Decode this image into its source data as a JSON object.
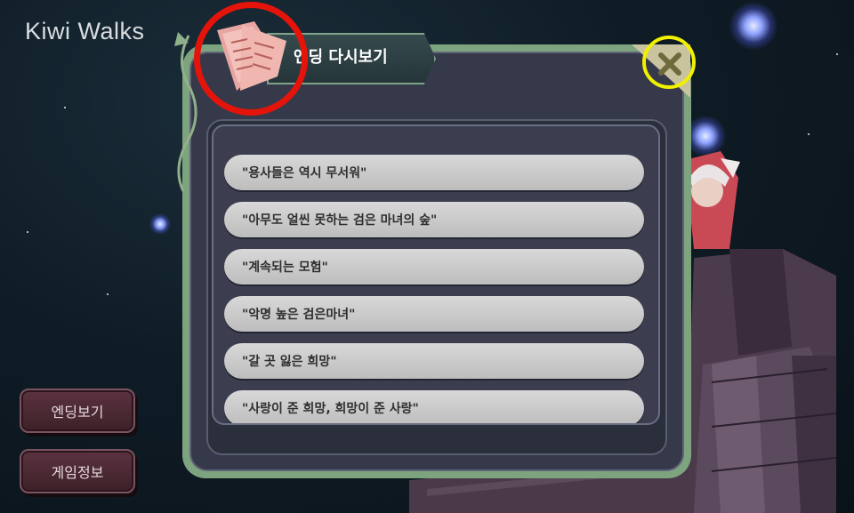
{
  "app": {
    "logo_text": "Kiwi Walks"
  },
  "side_menu": {
    "items": [
      {
        "label": "엔딩보기"
      },
      {
        "label": "게임정보"
      }
    ]
  },
  "dialog": {
    "title": "엔딩 다시보기",
    "endings": [
      {
        "label": "\"용사들은 역시 무서워\""
      },
      {
        "label": "\"아무도 얼씬 못하는 검은 마녀의 숲\""
      },
      {
        "label": "\"계속되는 모험\""
      },
      {
        "label": "\"악명 높은 검은마녀\""
      },
      {
        "label": "\"갈 곳 잃은 희망\""
      },
      {
        "label": "\"사랑이 준 희망, 희망이 준 사랑\""
      }
    ]
  },
  "colors": {
    "dialog_border": "#7ea47f",
    "dialog_panel": "#36394a",
    "row_fill": "#cfcfcf",
    "annotation_red": "#e5140b",
    "annotation_yellow": "#f0f000"
  },
  "icons": {
    "book": "open-book-icon",
    "close": "close-x-icon"
  }
}
